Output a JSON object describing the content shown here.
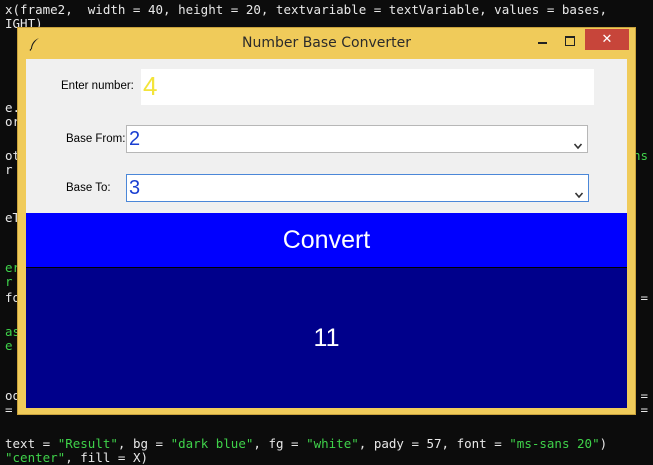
{
  "terminal": {
    "lines": [
      {
        "text": "x(frame2,  width = 40, height = 20, textvariable = textVariable, values = bases,",
        "color": "default"
      },
      {
        "text": "IGHT)",
        "color": "default"
      },
      {
        "text": "e.",
        "color": "default"
      },
      {
        "text": "or",
        "color": "default"
      },
      {
        "text": "ot",
        "color": "default"
      },
      {
        "text": "r",
        "color": "default"
      },
      {
        "text": "eT",
        "color": "default"
      },
      {
        "text": "er",
        "color": "green"
      },
      {
        "text": "r",
        "color": "green"
      },
      {
        "text": "fo",
        "color": "default"
      },
      {
        "text": "as",
        "color": "green"
      },
      {
        "text": "e",
        "color": "green"
      },
      {
        "text": "oo",
        "color": "default"
      },
      {
        "text": "=",
        "color": "default"
      }
    ],
    "right_fragments": [
      {
        "text": "ns",
        "color": "green"
      },
      {
        "text": "=",
        "color": "default"
      },
      {
        "text": "=",
        "color": "default"
      },
      {
        "text": "=",
        "color": "default"
      }
    ],
    "bottom_line": {
      "p1": "text = ",
      "p2": "\"Result\"",
      "p3": ", bg = ",
      "p4": "\"dark blue\"",
      "p5": ", fg = ",
      "p6": "\"white\"",
      "p7": ", pady = 57, font = ",
      "p8": "\"ms-sans 20\"",
      "p9": ")"
    },
    "last_line": {
      "p1": "\"center\"",
      "p2": ", fill = X)"
    }
  },
  "window": {
    "title": "Number Base Converter",
    "icon": "feather-icon",
    "controls": {
      "close": "✕"
    }
  },
  "form": {
    "number_label": "Enter number:",
    "number_value": "4",
    "from_label": "Base From:",
    "from_value": "2",
    "to_label": "Base To:",
    "to_value": "3"
  },
  "convert": {
    "label": "Convert"
  },
  "result": {
    "value": "11"
  },
  "colors": {
    "window_frame": "#f0cb5a",
    "convert_bg": "#0000ff",
    "result_bg": "#00008b",
    "entry_text": "#f3e43a",
    "select_text": "#1a3fd1",
    "close_button": "#c7453a"
  }
}
